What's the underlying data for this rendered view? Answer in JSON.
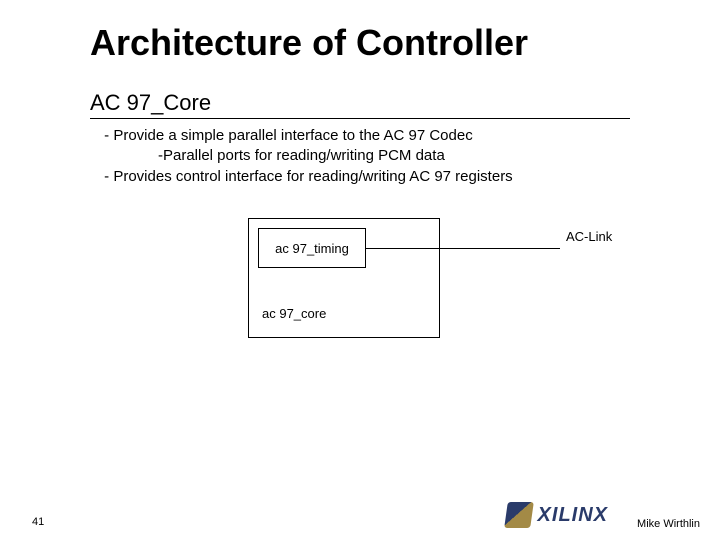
{
  "title": "Architecture of Controller",
  "subtitle": "AC 97_Core",
  "bullets": {
    "b0": " - Provide a simple parallel interface to the AC 97 Codec",
    "b1": "-Parallel ports for reading/writing PCM data",
    "b2": " - Provides control interface for reading/writing AC 97 registers"
  },
  "diagram": {
    "timing_label": "ac 97_timing",
    "core_label": "ac 97_core",
    "link_label": "AC-Link"
  },
  "footer": {
    "page": "41",
    "brand": "XILINX",
    "author": "Mike Wirthlin"
  }
}
